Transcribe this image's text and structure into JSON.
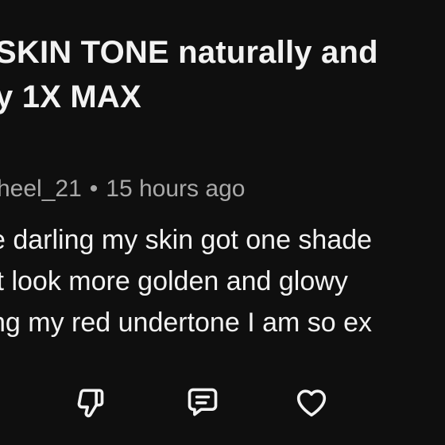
{
  "post": {
    "title_line1": "SKIN TONE naturally and",
    "title_line2": "y 1X MAX"
  },
  "comment": {
    "author": "heel_21",
    "separator": "•",
    "timestamp": "15 hours ago",
    "lines": [
      "e darling my skin got one shade",
      " it look more golden and glowy",
      "ng my red undertone I am so ex"
    ]
  },
  "actions": {
    "icons": [
      "thumbs-down-icon",
      "comment-icon",
      "heart-icon"
    ],
    "icon_color": "#f2f2f2"
  },
  "colors": {
    "background": "#0f0f0f",
    "text": "#f2f2f2",
    "meta_text": "#a9a9a9"
  }
}
